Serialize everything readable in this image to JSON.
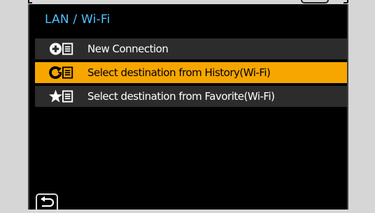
{
  "screen": {
    "title": "LAN / Wi-Fi"
  },
  "menu": {
    "items": [
      {
        "label": "New Connection",
        "icon": "add-list-icon",
        "selected": false
      },
      {
        "label": "Select destination from History(Wi-Fi)",
        "icon": "history-list-icon",
        "selected": true
      },
      {
        "label": "Select destination from Favorite(Wi-Fi)",
        "icon": "favorite-list-icon",
        "selected": false
      }
    ]
  },
  "back_button": {
    "icon": "return-icon"
  },
  "colors": {
    "title": "#4fc3ff",
    "row_background": "#2c2c2c",
    "selected_background": "#f7a600",
    "screen_background": "#000000",
    "frame_background": "#d6d6d6"
  }
}
